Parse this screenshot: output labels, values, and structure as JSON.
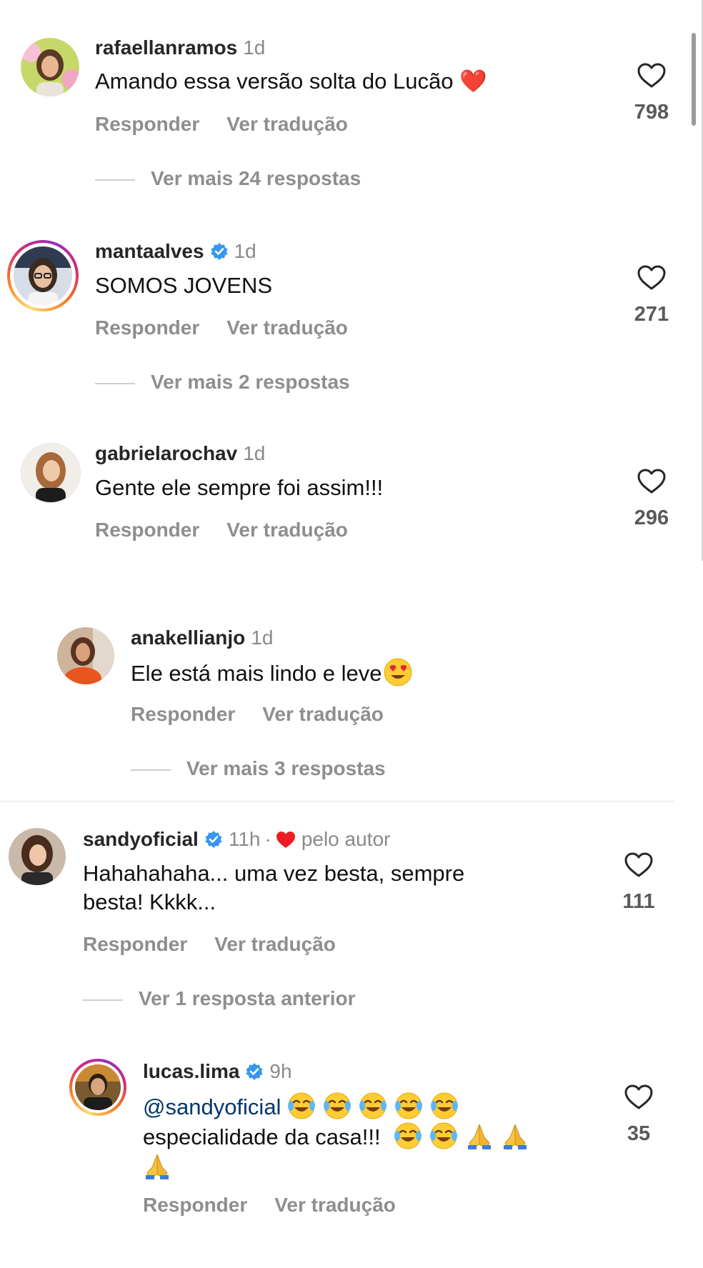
{
  "comments": [
    {
      "username": "rafaellanramos",
      "time": "1d",
      "text": "Amando essa versão solta do Lucão ❤️",
      "reply": "Responder",
      "translate": "Ver tradução",
      "likes": "798",
      "more": "Ver mais 24 respostas"
    },
    {
      "username": "mantaalves",
      "time": "1d",
      "text": "SOMOS JOVENS",
      "reply": "Responder",
      "translate": "Ver tradução",
      "likes": "271",
      "more": "Ver mais 2 respostas"
    },
    {
      "username": "gabrielarochav",
      "time": "1d",
      "text": "Gente ele sempre foi assim!!!",
      "reply": "Responder",
      "translate": "Ver tradução",
      "likes": "296"
    },
    {
      "username": "anakellianjo",
      "time": "1d",
      "text": "Ele está mais lindo e leve",
      "reply": "Responder",
      "translate": "Ver tradução",
      "more": "Ver mais 3 respostas"
    },
    {
      "username": "sandyoficial",
      "time": "11h",
      "separator": "·",
      "author_label": "pelo autor",
      "text_line1": "Hahahahaha... uma vez besta, sempre",
      "text_line2": "besta! Kkkk...",
      "reply": "Responder",
      "translate": "Ver tradução",
      "likes": "111",
      "more": "Ver 1 resposta anterior"
    },
    {
      "username": "lucas.lima",
      "time": "9h",
      "mention": "@sandyoficial",
      "text_line2": "especialidade da casa!!!",
      "reply": "Responder",
      "translate": "Ver tradução",
      "likes": "35"
    }
  ],
  "icons": {
    "like": "heart-outline-icon",
    "verified": "verified-badge-icon",
    "author_like": "red-heart-icon"
  },
  "colors": {
    "verified_blue": "#3797f0",
    "heart_red": "#ed1c24",
    "secondary_text": "#8e8e8e",
    "mention": "#00376b"
  }
}
